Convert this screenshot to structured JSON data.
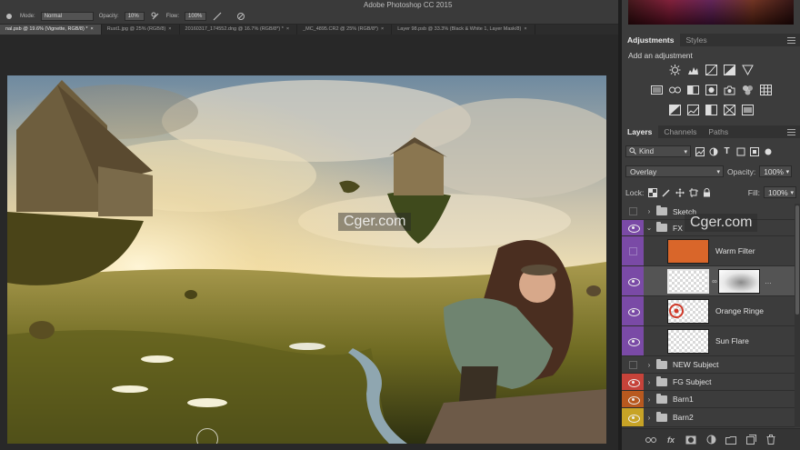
{
  "app": {
    "title": "Adobe Photoshop CC 2015"
  },
  "options_bar": {
    "mode_label": "Mode:",
    "mode_value": "Normal",
    "opacity_label": "Opacity:",
    "opacity_value": "10%",
    "flow_label": "Flow:",
    "flow_value": "100%"
  },
  "doc_tabs": [
    {
      "label": "nal.psb @ 19.6% (Vignette, RGB/8) *",
      "active": true
    },
    {
      "label": "Rust1.jpg @ 25% (RGB/8)"
    },
    {
      "label": "20160317_174552.dng @ 16.7% (RGB/8*) *"
    },
    {
      "label": "_MC_4895.CR2 @ 25% (RGB/8*)"
    },
    {
      "label": "Layer 98.psb @ 33.3% (Black & White 1, Layer Mask/8)"
    }
  ],
  "adjustments_panel": {
    "tabs": [
      "Adjustments",
      "Styles"
    ],
    "add_label": "Add an adjustment",
    "icons_row1": [
      "brightness-contrast-icon",
      "levels-icon",
      "curves-icon",
      "exposure-icon",
      "gradient-triangle-icon"
    ],
    "icons_row2": [
      "vibrance-icon",
      "hue-saturation-icon",
      "color-balance-icon",
      "black-white-icon",
      "photo-filter-icon",
      "channel-mixer-icon",
      "color-lookup-icon"
    ],
    "icons_row3": [
      "invert-icon",
      "posterize-icon",
      "threshold-icon",
      "selective-color-icon",
      "gradient-map-icon"
    ]
  },
  "layers_panel": {
    "tabs": [
      "Layers",
      "Channels",
      "Paths"
    ],
    "filter_kind": "Kind",
    "blend_mode": "Overlay",
    "opacity_label": "Opacity:",
    "opacity_value": "100%",
    "lock_label": "Lock:",
    "fill_label": "Fill:",
    "fill_value": "100%",
    "layers": [
      {
        "name": "Sketch",
        "type": "group",
        "visible": false,
        "label_color": "none",
        "expanded": false
      },
      {
        "name": "FX",
        "type": "group",
        "visible": true,
        "label_color": "violet",
        "expanded": true
      },
      {
        "name": "Warm Filter",
        "type": "fill",
        "visible": false,
        "label_color": "violet"
      },
      {
        "name": "",
        "type": "pixel-with-mask",
        "visible": true,
        "label_color": "violet",
        "selected": true
      },
      {
        "name": "Orange Ringe",
        "type": "pixel",
        "visible": true,
        "label_color": "violet"
      },
      {
        "name": "Sun Flare",
        "type": "pixel",
        "visible": true,
        "label_color": "violet"
      },
      {
        "name": "NEW Subject",
        "type": "group",
        "visible": false,
        "label_color": "none",
        "expanded": false
      },
      {
        "name": "FG Subject",
        "type": "group",
        "visible": true,
        "label_color": "red",
        "expanded": false
      },
      {
        "name": "Barn1",
        "type": "group",
        "visible": true,
        "label_color": "orange",
        "expanded": false
      },
      {
        "name": "Barn2",
        "type": "group",
        "visible": true,
        "label_color": "yellow",
        "expanded": false
      }
    ]
  },
  "watermarks": [
    "Cger.com",
    "Cger.com"
  ],
  "colors": {
    "violet": "#7a4aa6",
    "red": "#c6433a",
    "orange": "#b8591f",
    "yellow": "#c7a326",
    "panel_bg": "#3c3c3c"
  }
}
